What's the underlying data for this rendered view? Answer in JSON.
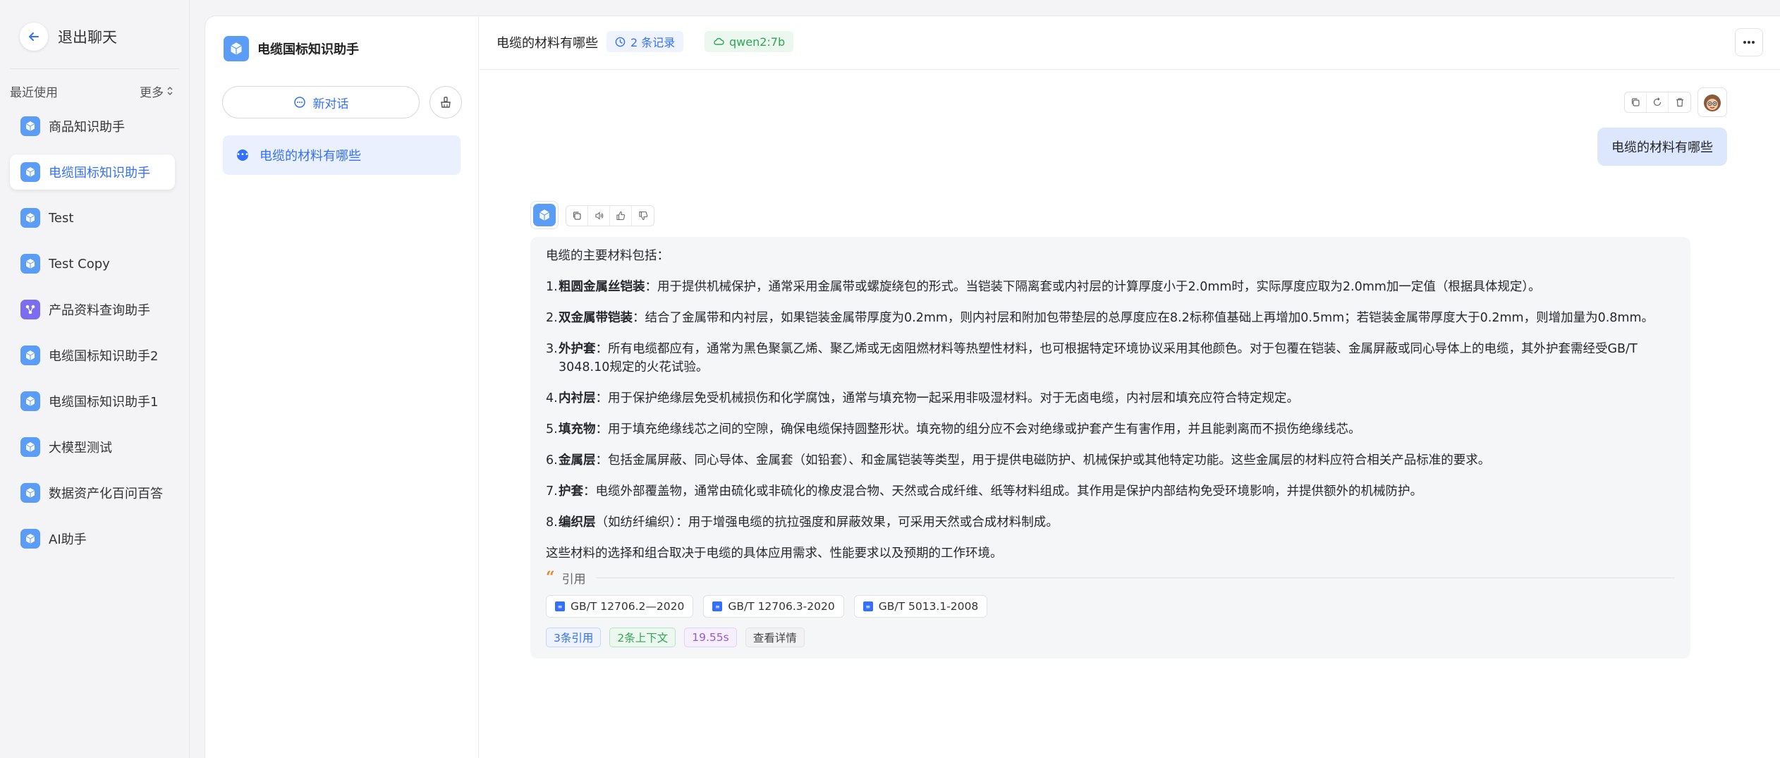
{
  "sidebar": {
    "back_label": "退出聊天",
    "recent_label": "最近使用",
    "more_label": "更多",
    "items": [
      {
        "label": "商品知识助手",
        "icon": "cube-app-icon"
      },
      {
        "label": "电缆国标知识助手",
        "icon": "cube-app-icon",
        "active": true
      },
      {
        "label": "Test",
        "icon": "cube-app-icon"
      },
      {
        "label": "Test Copy",
        "icon": "cube-app-icon"
      },
      {
        "label": "产品资料查询助手",
        "icon": "workflow-app-icon"
      },
      {
        "label": "电缆国标知识助手2",
        "icon": "cube-app-icon"
      },
      {
        "label": "电缆国标知识助手1",
        "icon": "cube-app-icon"
      },
      {
        "label": "大模型测试",
        "icon": "cube-app-icon"
      },
      {
        "label": "数据资产化百问百答",
        "icon": "cube-app-icon"
      },
      {
        "label": "AI助手",
        "icon": "cube-app-icon"
      }
    ]
  },
  "conversations": {
    "app_name": "电缆国标知识助手",
    "new_chat_label": "新对话",
    "items": [
      {
        "title": "电缆的材料有哪些"
      }
    ]
  },
  "chat": {
    "title": "电缆的材料有哪些",
    "records_tag": "2 条记录",
    "model_tag": "qwen2:7b",
    "user_message": "电缆的材料有哪些",
    "answer": {
      "intro": "电缆的主要材料包括：",
      "items": [
        {
          "num": "1.",
          "term": "粗圆金属丝铠装",
          "text": "：用于提供机械保护，通常采用金属带或螺旋绕包的形式。当铠装下隔离套或内衬层的计算厚度小于2.0mm时，实际厚度应取为2.0mm加一定值（根据具体规定）。"
        },
        {
          "num": "2.",
          "term": "双金属带铠装",
          "text": "：结合了金属带和内衬层，如果铠装金属带厚度为0.2mm，则内衬层和附加包带垫层的总厚度应在8.2标称值基础上再增加0.5mm；若铠装金属带厚度大于0.2mm，则增加量为0.8mm。"
        },
        {
          "num": "3.",
          "term": "外护套",
          "text": "：所有电缆都应有，通常为黑色聚氯乙烯、聚乙烯或无卤阻燃材料等热塑性材料，也可根据特定环境协议采用其他颜色。对于包覆在铠装、金属屏蔽或同心导体上的电缆，其外护套需经受GB/T 3048.10规定的火花试验。"
        },
        {
          "num": "4.",
          "term": "内衬层",
          "text": "：用于保护绝缘层免受机械损伤和化学腐蚀，通常与填充物一起采用非吸湿材料。对于无卤电缆，内衬层和填充应符合特定规定。"
        },
        {
          "num": "5.",
          "term": "填充物",
          "text": "：用于填充绝缘线芯之间的空隙，确保电缆保持圆整形状。填充物的组分应不会对绝缘或护套产生有害作用，并且能剥离而不损伤绝缘线芯。"
        },
        {
          "num": "6.",
          "term": "金属层",
          "text": "：包括金属屏蔽、同心导体、金属套（如铅套）、和金属铠装等类型，用于提供电磁防护、机械保护或其他特定功能。这些金属层的材料应符合相关产品标准的要求。"
        },
        {
          "num": "7.",
          "term": "护套",
          "text": "：电缆外部覆盖物，通常由硫化或非硫化的橡皮混合物、天然或合成纤维、纸等材料组成。其作用是保护内部结构免受环境影响，并提供额外的机械防护。"
        },
        {
          "num": "8.",
          "term": "编织层",
          "text": "（如纺纤编织）：用于增强电缆的抗拉强度和屏蔽效果，可采用天然或合成材料制成。"
        }
      ],
      "outro": "这些材料的选择和组合取决于电缆的具体应用需求、性能要求以及预期的工作环境。",
      "quote_label": "引用",
      "citations": [
        "GB/T 12706.2—2020",
        "GB/T 12706.3-2020",
        "GB/T 5013.1-2008"
      ],
      "stats": {
        "cite_count": "3条引用",
        "context_count": "2条上下文",
        "time": "19.55s",
        "detail": "查看详情"
      }
    }
  },
  "colors": {
    "accent": "#3370ff",
    "green": "#2fa555",
    "purple": "#9b59d0",
    "quote": "#e48a2b"
  }
}
